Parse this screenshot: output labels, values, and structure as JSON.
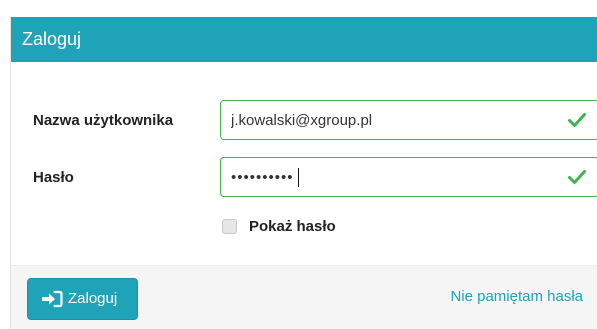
{
  "panel": {
    "title": "Zaloguj"
  },
  "form": {
    "username": {
      "label": "Nazwa użytkownika",
      "value": "j.kowalski@xgroup.pl",
      "valid": true,
      "status_icon": "checkmark-icon"
    },
    "password": {
      "label": "Hasło",
      "value": "••••••••••",
      "valid": true,
      "status_icon": "checkmark-icon"
    },
    "show_password": {
      "label": "Pokaż hasło",
      "checked": false
    }
  },
  "footer": {
    "login_button": {
      "label": "Zaloguj",
      "icon": "sign-in-icon"
    },
    "forgot_link": "Nie pamiętam hasła"
  },
  "colors": {
    "accent": "#1fa3b8",
    "success": "#3fb54b",
    "footer_bg": "#f5f5f5"
  }
}
